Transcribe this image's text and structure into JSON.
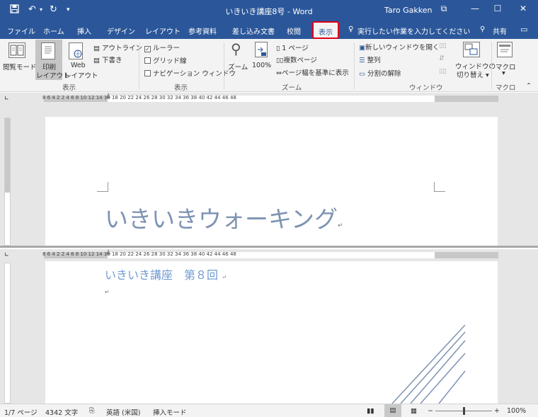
{
  "window": {
    "title": "いきいき講座8号 - Word",
    "user": "Taro Gakken",
    "controls": {
      "restore": "⧉",
      "minimize": "—",
      "maximize": "☐",
      "close": "✕"
    }
  },
  "quick_access": {
    "save_icon": "save-icon",
    "undo_icon": "undo-icon",
    "redo_icon": "redo-icon",
    "customize_icon": "customize-icon"
  },
  "tabs": [
    "ファイル",
    "ホーム",
    "挿入",
    "デザイン",
    "レイアウト",
    "参考資料",
    "差し込み文書",
    "校閲",
    "表示"
  ],
  "active_tab": "表示",
  "tell_me": "実行したい作業を入力してください",
  "share": "共有",
  "ribbon": {
    "views": {
      "read_mode": "閲覧モード",
      "print_layout_1": "印刷",
      "print_layout_2": "レイアウト",
      "web_layout_1": "Web",
      "web_layout_2": "レイアウト",
      "outline": "アウトライン",
      "draft": "下書き",
      "label": "表示"
    },
    "show": {
      "ruler": "ルーラー",
      "gridlines": "グリッド線",
      "navigation": "ナビゲーション ウィンドウ",
      "label": "表示",
      "ruler_checked": true,
      "gridlines_checked": false,
      "navigation_checked": false
    },
    "zoom": {
      "zoom_label": "ズーム",
      "hundred": "100%",
      "one_page": "1 ページ",
      "multiple_pages": "複数ページ",
      "page_width": "ページ幅を基準に表示",
      "label": "ズーム"
    },
    "window": {
      "new_window": "新しいウィンドウを開く",
      "arrange": "整列",
      "remove_split": "分割の解除",
      "switch_1": "ウィンドウの",
      "switch_2": "切り替え",
      "label": "ウィンドウ"
    },
    "macros": {
      "label_btn": "マクロ",
      "label": "マクロ"
    }
  },
  "ruler": {
    "numbers": "8   6   4   2       2   4   6   8   10  12  14  16  18  20  22  24  26  28  30  32  34  36  38  40  42  44  46  48"
  },
  "document": {
    "heading": "いきいきウォーキング",
    "subheading": "いきいき講座　第８回",
    "para_mark": "↵"
  },
  "status": {
    "page": "1/7 ページ",
    "words": "4342 文字",
    "language": "英語 (米国)",
    "mode": "挿入モード",
    "zoom": "100%",
    "zoom_level": 1.0
  },
  "colors": {
    "brand": "#2b579a",
    "highlight": "#e0001b",
    "heading": "#7d93b2",
    "subheading": "#6f9bd1"
  }
}
